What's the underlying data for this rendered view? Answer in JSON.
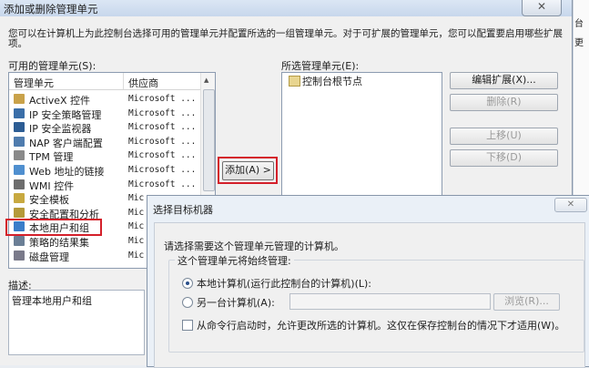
{
  "dialog": {
    "title": "添加或删除管理单元",
    "close_symbol": "✕",
    "description": "您可以在计算机上为此控制台选择可用的管理单元并配置所选的一组管理单元。对于可扩展的管理单元，您可以配置要启用哪些扩展项。",
    "available_label": "可用的管理单元(S):",
    "selected_label": "所选管理单元(E):",
    "columns": {
      "snapin": "管理单元",
      "vendor": "供应商"
    },
    "items": [
      {
        "name": "ActiveX 控件",
        "vendor": "Microsoft ...",
        "icon": "activex-icon"
      },
      {
        "name": "IP 安全策略管理",
        "vendor": "Microsoft ...",
        "icon": "ip-security-policy-icon"
      },
      {
        "name": "IP 安全监视器",
        "vendor": "Microsoft ...",
        "icon": "ip-security-monitor-icon"
      },
      {
        "name": "NAP 客户端配置",
        "vendor": "Microsoft ...",
        "icon": "nap-client-icon"
      },
      {
        "name": "TPM 管理",
        "vendor": "Microsoft ...",
        "icon": "tpm-icon"
      },
      {
        "name": "Web 地址的链接",
        "vendor": "Microsoft ...",
        "icon": "web-link-icon"
      },
      {
        "name": "WMI 控件",
        "vendor": "Microsoft ...",
        "icon": "wmi-icon"
      },
      {
        "name": "安全模板",
        "vendor": "Mic",
        "icon": "security-template-icon"
      },
      {
        "name": "安全配置和分析",
        "vendor": "Mic",
        "icon": "security-config-icon"
      },
      {
        "name": "本地用户和组",
        "vendor": "Mic",
        "icon": "local-users-icon"
      },
      {
        "name": "策略的结果集",
        "vendor": "Mic",
        "icon": "rsop-icon"
      },
      {
        "name": "磁盘管理",
        "vendor": "Mic",
        "icon": "disk-management-icon"
      }
    ],
    "selected_items": [
      "控制台根节点"
    ],
    "add_button": "添加(A) >",
    "buttons": {
      "edit_ext": "编辑扩展(X)...",
      "remove": "删除(R)",
      "up": "上移(U)",
      "down": "下移(D)"
    },
    "description_label": "描述:",
    "description_text": "管理本地用户和组",
    "colors": {
      "highlight": "#d4202a",
      "dialog_bg": "#f0f0f0"
    }
  },
  "right_strip": {
    "a": "台",
    "b": "更"
  },
  "sub_dialog": {
    "title": "选择目标机器",
    "close_symbol": "✕",
    "prompt": "请选择需要这个管理单元管理的计算机。",
    "group_label": "这个管理单元将始终管理:",
    "radio_local": "本地计算机(运行此控制台的计算机)(L):",
    "radio_other": "另一台计算机(A):",
    "other_computer_value": "",
    "browse": "浏览(R)...",
    "checkbox": "从命令行启动时，允许更改所选的计算机。这仅在保存控制台的情况下才适用(W)。"
  }
}
